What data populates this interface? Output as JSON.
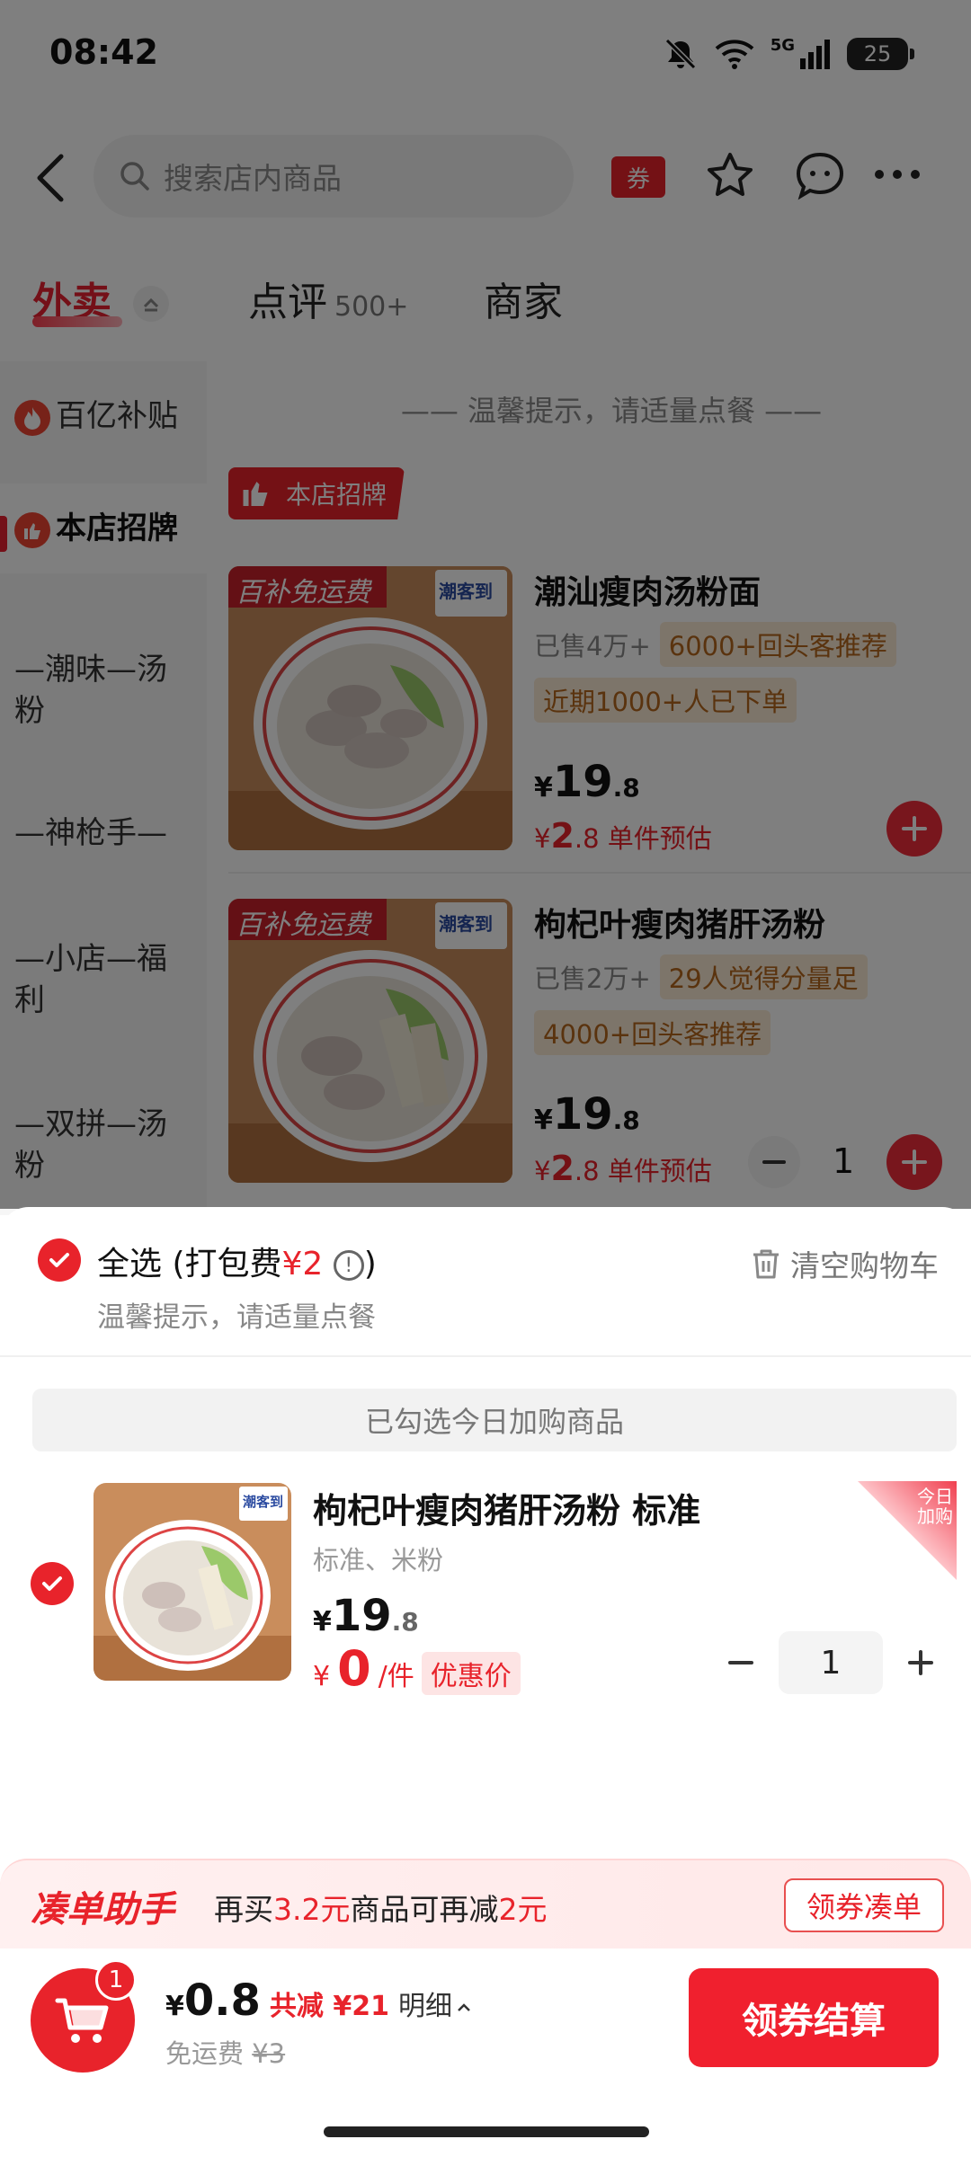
{
  "status_bar": {
    "time": "08:42",
    "network": "5G",
    "battery": "25"
  },
  "header": {
    "search_placeholder": "搜索店内商品",
    "coupon_label": "券"
  },
  "tabs": [
    {
      "label": "外卖"
    },
    {
      "label": "点评",
      "count": "500+"
    },
    {
      "label": "商家"
    }
  ],
  "sidebar": {
    "items": [
      {
        "label": "百亿补贴"
      },
      {
        "label": "本店招牌"
      },
      {
        "label": "—潮味—汤粉"
      },
      {
        "label": "—神枪手—"
      },
      {
        "label": "—小店—福利"
      },
      {
        "label": "—双拼—汤粉"
      }
    ]
  },
  "menu": {
    "tip": "—— 温馨提示，请适量点餐 ——",
    "section_badge": "本店招牌",
    "products": [
      {
        "promo_overlay": "百补免运费",
        "brand": "潮客到",
        "name": "潮汕瘦肉汤粉面",
        "sold": "已售4万+",
        "tags": [
          "6000+回头客推荐",
          "近期1000+人已下单"
        ],
        "currency": "¥",
        "price_int": "19",
        "price_dec": ".8",
        "est_currency": "¥",
        "est_int": "2",
        "est_dec": ".8",
        "est_label": "单件预估"
      },
      {
        "promo_overlay": "百补免运费",
        "brand": "潮客到",
        "name": "枸杞叶瘦肉猪肝汤粉",
        "sold": "已售2万+",
        "tags": [
          "29人觉得分量足",
          "4000+回头客推荐"
        ],
        "currency": "¥",
        "price_int": "19",
        "price_dec": ".8",
        "est_currency": "¥",
        "est_int": "2",
        "est_dec": ".8",
        "est_label": "单件预估",
        "quantity": "1"
      }
    ]
  },
  "cart": {
    "select_all": "全选",
    "packing_prefix": "(打包费",
    "packing_fee": "¥2",
    "packing_suffix": ")",
    "clear_label": "清空购物车",
    "warm_tip": "温馨提示，请适量点餐",
    "section_banner": "已勾选今日加购商品",
    "item": {
      "brand": "潮客到",
      "name": "枸杞叶瘦肉猪肝汤粉 标准",
      "spec": "标准、米粉",
      "currency": "¥",
      "price_int": "19",
      "price_dec": ".8",
      "now_currency": "¥",
      "now_price": "0",
      "per_unit": "/件",
      "deal_tag": "优惠价",
      "corner_tag_1": "今日",
      "corner_tag_2": "加购",
      "quantity": "1"
    }
  },
  "promo": {
    "title": "凑单助手",
    "text_1": "再买",
    "amount_1": "3.2元",
    "text_2": "商品可再减",
    "amount_2": "2元",
    "button": "领券凑单"
  },
  "bottom_bar": {
    "cart_count": "1",
    "currency": "¥",
    "total": "0.8",
    "saved": "共减 ¥21",
    "detail": "明细",
    "fee_label": "免运费",
    "fee_orig": "¥3",
    "checkout": "领券结算"
  },
  "colors": {
    "accent": "#e8232b",
    "tag_bg": "#fbebd4",
    "tag_text": "#b5661c"
  }
}
